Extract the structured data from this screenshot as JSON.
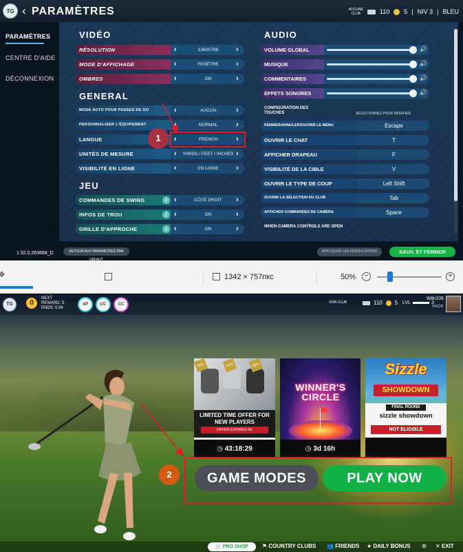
{
  "settings": {
    "title": "PARAMÈTRES",
    "top_right": {
      "club": "AUCUNE\nCLUB",
      "coins": "110",
      "balls": "5",
      "level": "NIV 3",
      "team": "BLEU"
    },
    "nav": [
      "PARAMÈTRES",
      "CENTRE D'AIDE",
      "DÉCONNEXION"
    ],
    "version": "1.92.0.263668_D",
    "video": {
      "title": "VIDÉO",
      "rows": [
        {
          "label": "RÉSOLUTION",
          "value": "1360X768"
        },
        {
          "label": "MODE D'AFFICHAGE",
          "value": "FENÊTRE"
        },
        {
          "label": "OMBRES",
          "value": "ON"
        }
      ]
    },
    "general": {
      "title": "GENERAL",
      "rows": [
        {
          "label": "MODE AUTO POUR PASSES DE GO",
          "value": "AUCUN"
        },
        {
          "label": "PERSONNALISER L'ÉQUIPEMENT",
          "value": "NORMAL"
        },
        {
          "label": "LANGUE",
          "value": "FRENCH"
        },
        {
          "label": "UNITÉS DE MESURE",
          "value": "YARDS / FEET / INCHES"
        },
        {
          "label": "VISIBILITÉ EN LIGNE",
          "value": "EN LIGNE"
        }
      ]
    },
    "jeu": {
      "title": "JEU",
      "rows": [
        {
          "label": "COMMANDES DE SWING",
          "value": "CÔTÉ DROIT"
        },
        {
          "label": "INFOS DE TROU",
          "value": "ON"
        },
        {
          "label": "GRILLE D'APPROCHE",
          "value": "ON"
        }
      ]
    },
    "audio": {
      "title": "AUDIO",
      "sliders": [
        {
          "label": "VOLUME GLOBAL",
          "level": 0.96
        },
        {
          "label": "MUSIQUE",
          "level": 0.96
        },
        {
          "label": "COMMENTAIRES",
          "level": 0.96
        },
        {
          "label": "EFFETS SONORES",
          "level": 0.96
        }
      ]
    },
    "keys": {
      "head": "CONFIGURATION DES TOUCHES",
      "sub": "SÉLECTIONNEZ POUR MODIFIER",
      "rows": [
        {
          "label": "FERMER/ANNULER/OUVRIR LE MENU",
          "key": "Escape"
        },
        {
          "label": "OUVRIR LE CHAT",
          "key": "T"
        },
        {
          "label": "AFFICHER DRAPEAU",
          "key": "F"
        },
        {
          "label": "VISIBILITÉ DE LA CIBLE",
          "key": "V"
        },
        {
          "label": "OUVRIR LE TYPE DE COUP",
          "key": "Left Shift"
        },
        {
          "label": "OUVRIR LA SÉLECTION DU CLUB",
          "key": "Tab"
        },
        {
          "label": "AFFICHER COMMANDES DE CAMÉRA",
          "key": "Space"
        }
      ],
      "camera_head": "WHEN CAMERA CONTROLS ARE OPEN"
    },
    "buttons": {
      "reset": "RETOUR AUX PARAMÈTRES PAR DÉFAUT",
      "apply": "APPLIQUER LES MODIFICATIONS",
      "save": "SAUV. ET FERMER"
    },
    "badge": "1"
  },
  "editor": {
    "size": "1342 × 757пкс",
    "zoom": "50%",
    "zoom_level": 0.2
  },
  "game": {
    "reward": {
      "label_next": "NEXT",
      "label_reward": "REWARD:",
      "reward_value": "5",
      "label_ends": "ENDS:",
      "ends_value": "0:34"
    },
    "challenges": [
      "XP",
      "CC",
      "CC"
    ],
    "club": "JOIN CLUB",
    "coins": "110",
    "balls": "5",
    "level": "LVL",
    "level_value": "3",
    "username": "Wiki109",
    "user_club": "HACK",
    "cards": {
      "offer": {
        "badge": "50%",
        "title": "LIMITED TIME OFFER FOR NEW PLAYERS",
        "expires": "OFFER EXPIRES IN:",
        "timer": "43:18:29"
      },
      "winners": {
        "title": "WINNER'S CIRCLE",
        "timer": "3d 16h"
      },
      "sizzle": {
        "logo": "Sizzle",
        "banner": "SHOWDOWN",
        "round": "FINAL ROUND",
        "name": "sizzle showdown",
        "status": "NOT ELIGIBLE"
      }
    },
    "buttons": {
      "modes": "GAME MODES",
      "play": "PLAY NOW"
    },
    "badge": "2",
    "bottom": {
      "pro_shop": "PRO SHOP",
      "country_clubs": "COUNTRY CLUBS",
      "friends": "FRIENDS",
      "daily_bonus": "DAILY BONUS",
      "exit": "EXIT"
    }
  }
}
